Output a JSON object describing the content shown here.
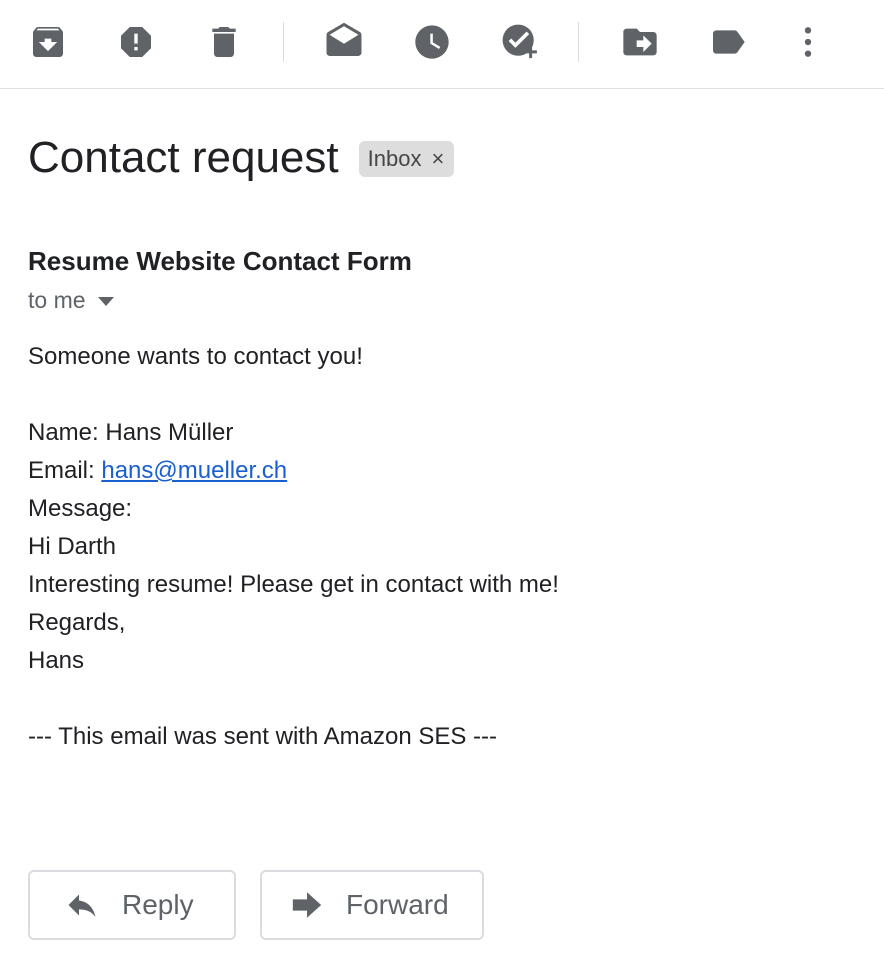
{
  "toolbar": {
    "buttons": [
      {
        "name": "archive-icon"
      },
      {
        "name": "report-spam-icon"
      },
      {
        "name": "delete-icon"
      },
      {
        "name": "mark-unread-icon"
      },
      {
        "name": "snooze-icon"
      },
      {
        "name": "add-to-tasks-icon"
      },
      {
        "name": "move-to-icon"
      },
      {
        "name": "labels-icon"
      },
      {
        "name": "more-options-icon"
      }
    ],
    "icon_color": "#5f6368"
  },
  "email": {
    "subject": "Contact request",
    "label_chip": "Inbox",
    "label_remove": "×",
    "sender": "Resume Website Contact Form",
    "recipient": "to me",
    "body_lines": [
      "Someone wants to contact you!",
      "",
      "Name: Hans Müller",
      "Email: ",
      "Message:",
      "Hi Darth",
      "Interesting resume! Please get in contact with me!",
      "Regards,",
      "Hans",
      "",
      "--- This email was sent with Amazon SES ---"
    ],
    "email_link": "hans@mueller.ch"
  },
  "actions": {
    "reply_label": "Reply",
    "forward_label": "Forward"
  },
  "colors": {
    "link": "#1a5fd0",
    "chip_bg": "#dddddd",
    "border": "#dadce0"
  }
}
